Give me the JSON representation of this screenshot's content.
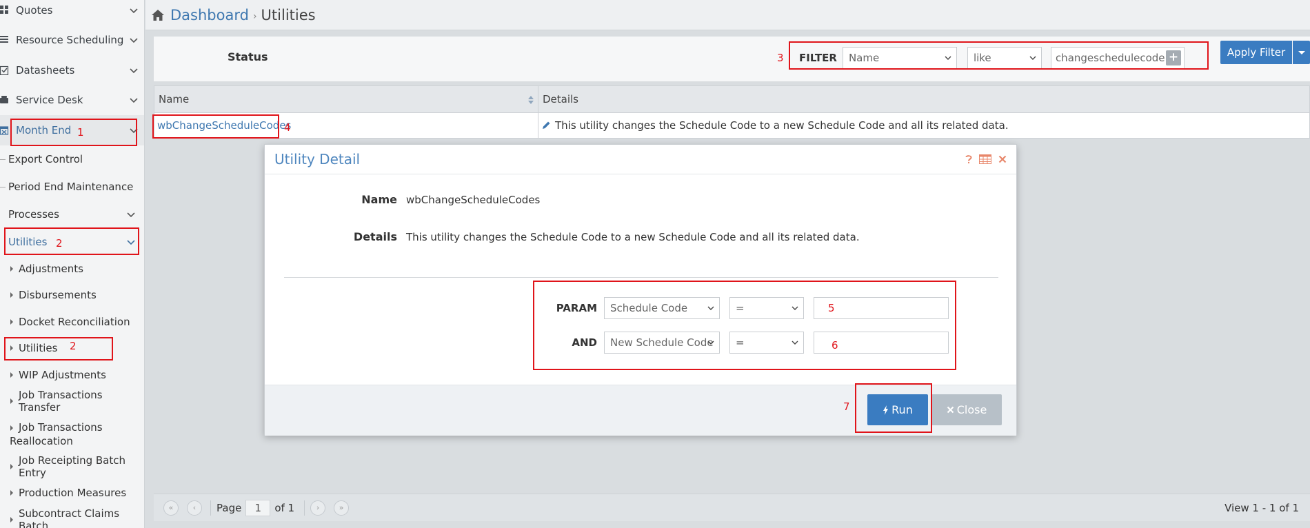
{
  "sidebar": {
    "top_items": [
      {
        "label": "Quotes",
        "icon": "grid-icon"
      },
      {
        "label": "Resource Scheduling",
        "icon": "list-icon"
      },
      {
        "label": "Datasheets",
        "icon": "checklist-icon"
      },
      {
        "label": "Service Desk",
        "icon": "phone-icon"
      },
      {
        "label": "Month End",
        "icon": "calendar-icon"
      }
    ],
    "month_end_items": [
      {
        "label": "Export Control"
      },
      {
        "label": "Period End Maintenance"
      },
      {
        "label": "Processes"
      },
      {
        "label": "Utilities"
      }
    ],
    "utilities_items": [
      {
        "label": "Adjustments"
      },
      {
        "label": "Disbursements"
      },
      {
        "label": "Docket Reconciliation"
      },
      {
        "label": "Utilities"
      },
      {
        "label": "WIP Adjustments"
      },
      {
        "label": "Job Transactions Transfer"
      },
      {
        "label": "Job Transactions Reallocation"
      },
      {
        "label": "Job Receipting Batch Entry"
      },
      {
        "label": "Production Measures"
      },
      {
        "label": "Subcontract Claims Batch"
      }
    ]
  },
  "breadcrumb": {
    "parent": "Dashboard",
    "current": "Utilities"
  },
  "toolbar": {
    "status_label": "Status",
    "filter_label": "FILTER",
    "filter_field": "Name",
    "filter_operator": "like",
    "filter_value": "changeschedulecode",
    "add_label": "+",
    "apply_label": "Apply Filter"
  },
  "grid": {
    "columns": [
      "Name",
      "Details"
    ],
    "rows": [
      {
        "name": "wbChangeScheduleCodes",
        "details": "This utility changes the Schedule Code to a new Schedule Code and all its related data."
      }
    ]
  },
  "pager": {
    "page_label": "Page",
    "page_value": "1",
    "of_label": "of 1",
    "view_text": "View 1 - 1 of 1"
  },
  "modal": {
    "title": "Utility Detail",
    "name_label": "Name",
    "name_value": "wbChangeScheduleCodes",
    "details_label": "Details",
    "details_value": "This utility changes the Schedule Code to a new Schedule Code and all its related data.",
    "params": [
      {
        "label": "PARAM",
        "field": "Schedule Code",
        "operator": "=",
        "value": ""
      },
      {
        "label": "AND",
        "field": "New Schedule Code",
        "operator": "=",
        "value": ""
      }
    ],
    "run_label": "Run",
    "close_label": "Close"
  },
  "annotations": [
    "1",
    "2",
    "2",
    "3",
    "4",
    "5",
    "6",
    "7"
  ],
  "colors": {
    "accent": "#3a7cc1",
    "link": "#3f78b0",
    "annotation": "#e0141a",
    "close_button": "#b7c0c8"
  }
}
